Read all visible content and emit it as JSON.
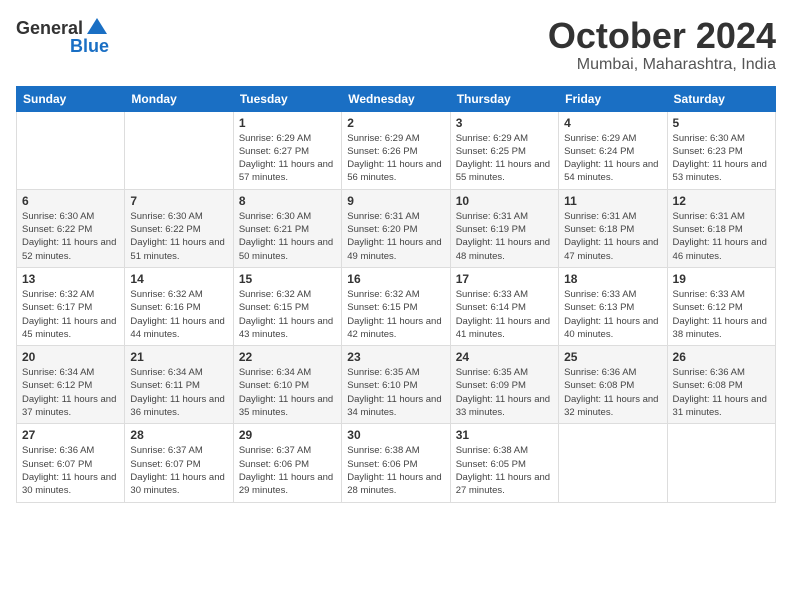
{
  "header": {
    "logo_general": "General",
    "logo_blue": "Blue",
    "month": "October 2024",
    "location": "Mumbai, Maharashtra, India"
  },
  "weekdays": [
    "Sunday",
    "Monday",
    "Tuesday",
    "Wednesday",
    "Thursday",
    "Friday",
    "Saturday"
  ],
  "weeks": [
    [
      {
        "day": "",
        "info": ""
      },
      {
        "day": "",
        "info": ""
      },
      {
        "day": "1",
        "info": "Sunrise: 6:29 AM\nSunset: 6:27 PM\nDaylight: 11 hours and 57 minutes."
      },
      {
        "day": "2",
        "info": "Sunrise: 6:29 AM\nSunset: 6:26 PM\nDaylight: 11 hours and 56 minutes."
      },
      {
        "day": "3",
        "info": "Sunrise: 6:29 AM\nSunset: 6:25 PM\nDaylight: 11 hours and 55 minutes."
      },
      {
        "day": "4",
        "info": "Sunrise: 6:29 AM\nSunset: 6:24 PM\nDaylight: 11 hours and 54 minutes."
      },
      {
        "day": "5",
        "info": "Sunrise: 6:30 AM\nSunset: 6:23 PM\nDaylight: 11 hours and 53 minutes."
      }
    ],
    [
      {
        "day": "6",
        "info": "Sunrise: 6:30 AM\nSunset: 6:22 PM\nDaylight: 11 hours and 52 minutes."
      },
      {
        "day": "7",
        "info": "Sunrise: 6:30 AM\nSunset: 6:22 PM\nDaylight: 11 hours and 51 minutes."
      },
      {
        "day": "8",
        "info": "Sunrise: 6:30 AM\nSunset: 6:21 PM\nDaylight: 11 hours and 50 minutes."
      },
      {
        "day": "9",
        "info": "Sunrise: 6:31 AM\nSunset: 6:20 PM\nDaylight: 11 hours and 49 minutes."
      },
      {
        "day": "10",
        "info": "Sunrise: 6:31 AM\nSunset: 6:19 PM\nDaylight: 11 hours and 48 minutes."
      },
      {
        "day": "11",
        "info": "Sunrise: 6:31 AM\nSunset: 6:18 PM\nDaylight: 11 hours and 47 minutes."
      },
      {
        "day": "12",
        "info": "Sunrise: 6:31 AM\nSunset: 6:18 PM\nDaylight: 11 hours and 46 minutes."
      }
    ],
    [
      {
        "day": "13",
        "info": "Sunrise: 6:32 AM\nSunset: 6:17 PM\nDaylight: 11 hours and 45 minutes."
      },
      {
        "day": "14",
        "info": "Sunrise: 6:32 AM\nSunset: 6:16 PM\nDaylight: 11 hours and 44 minutes."
      },
      {
        "day": "15",
        "info": "Sunrise: 6:32 AM\nSunset: 6:15 PM\nDaylight: 11 hours and 43 minutes."
      },
      {
        "day": "16",
        "info": "Sunrise: 6:32 AM\nSunset: 6:15 PM\nDaylight: 11 hours and 42 minutes."
      },
      {
        "day": "17",
        "info": "Sunrise: 6:33 AM\nSunset: 6:14 PM\nDaylight: 11 hours and 41 minutes."
      },
      {
        "day": "18",
        "info": "Sunrise: 6:33 AM\nSunset: 6:13 PM\nDaylight: 11 hours and 40 minutes."
      },
      {
        "day": "19",
        "info": "Sunrise: 6:33 AM\nSunset: 6:12 PM\nDaylight: 11 hours and 38 minutes."
      }
    ],
    [
      {
        "day": "20",
        "info": "Sunrise: 6:34 AM\nSunset: 6:12 PM\nDaylight: 11 hours and 37 minutes."
      },
      {
        "day": "21",
        "info": "Sunrise: 6:34 AM\nSunset: 6:11 PM\nDaylight: 11 hours and 36 minutes."
      },
      {
        "day": "22",
        "info": "Sunrise: 6:34 AM\nSunset: 6:10 PM\nDaylight: 11 hours and 35 minutes."
      },
      {
        "day": "23",
        "info": "Sunrise: 6:35 AM\nSunset: 6:10 PM\nDaylight: 11 hours and 34 minutes."
      },
      {
        "day": "24",
        "info": "Sunrise: 6:35 AM\nSunset: 6:09 PM\nDaylight: 11 hours and 33 minutes."
      },
      {
        "day": "25",
        "info": "Sunrise: 6:36 AM\nSunset: 6:08 PM\nDaylight: 11 hours and 32 minutes."
      },
      {
        "day": "26",
        "info": "Sunrise: 6:36 AM\nSunset: 6:08 PM\nDaylight: 11 hours and 31 minutes."
      }
    ],
    [
      {
        "day": "27",
        "info": "Sunrise: 6:36 AM\nSunset: 6:07 PM\nDaylight: 11 hours and 30 minutes."
      },
      {
        "day": "28",
        "info": "Sunrise: 6:37 AM\nSunset: 6:07 PM\nDaylight: 11 hours and 30 minutes."
      },
      {
        "day": "29",
        "info": "Sunrise: 6:37 AM\nSunset: 6:06 PM\nDaylight: 11 hours and 29 minutes."
      },
      {
        "day": "30",
        "info": "Sunrise: 6:38 AM\nSunset: 6:06 PM\nDaylight: 11 hours and 28 minutes."
      },
      {
        "day": "31",
        "info": "Sunrise: 6:38 AM\nSunset: 6:05 PM\nDaylight: 11 hours and 27 minutes."
      },
      {
        "day": "",
        "info": ""
      },
      {
        "day": "",
        "info": ""
      }
    ]
  ]
}
